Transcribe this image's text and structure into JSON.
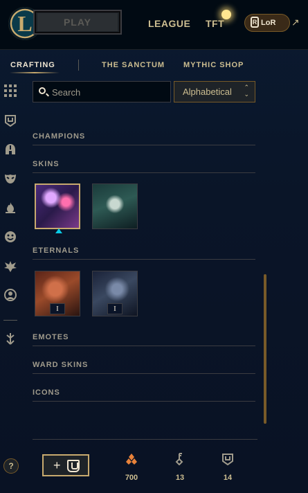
{
  "topbar": {
    "play_label": "PLAY",
    "league_label": "LEAGUE",
    "tft_label": "TFT",
    "lor_label": "LoR"
  },
  "subnav": {
    "crafting": "CRAFTING",
    "sanctum": "THE SANCTUM",
    "mythic_shop": "MYTHIC SHOP"
  },
  "toolbar": {
    "search_placeholder": "Search",
    "sort_value": "Alphabetical"
  },
  "sections": {
    "champions": "CHAMPIONS",
    "skins": "SKINS",
    "eternals": "ETERNALS",
    "emotes": "EMOTES",
    "ward_skins": "WARD SKINS",
    "icons": "ICONS"
  },
  "eternals": [
    {
      "level": "I"
    },
    {
      "level": "I"
    }
  ],
  "footer": {
    "help_label": "?",
    "craft_label": "+",
    "orange_essence": "700",
    "keys": "13",
    "chests": "14"
  },
  "colors": {
    "gold": "#c8aa6e",
    "gold_text": "#cdbe91",
    "accent_blue": "#0acbe6",
    "essence_orange": "#e8823a"
  }
}
